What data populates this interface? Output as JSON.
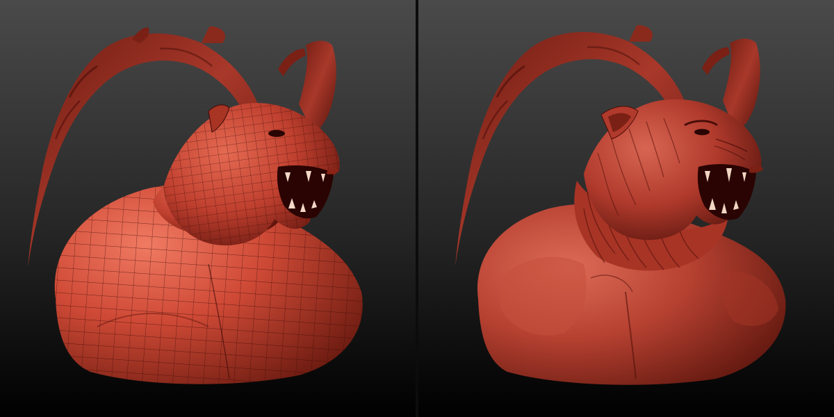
{
  "scene": {
    "background_top": "#4a4a4a",
    "background_bottom": "#000000",
    "clay_color": "#b8362a",
    "clay_highlight": "#e0664f",
    "clay_shadow": "#4a0d08",
    "wire_color": "#3a0806"
  },
  "panels": [
    {
      "name": "wireframe-bust",
      "style": "low-poly mesh with visible wireframe"
    },
    {
      "name": "sculpted-bust",
      "style": "high-detail sculpt"
    }
  ]
}
